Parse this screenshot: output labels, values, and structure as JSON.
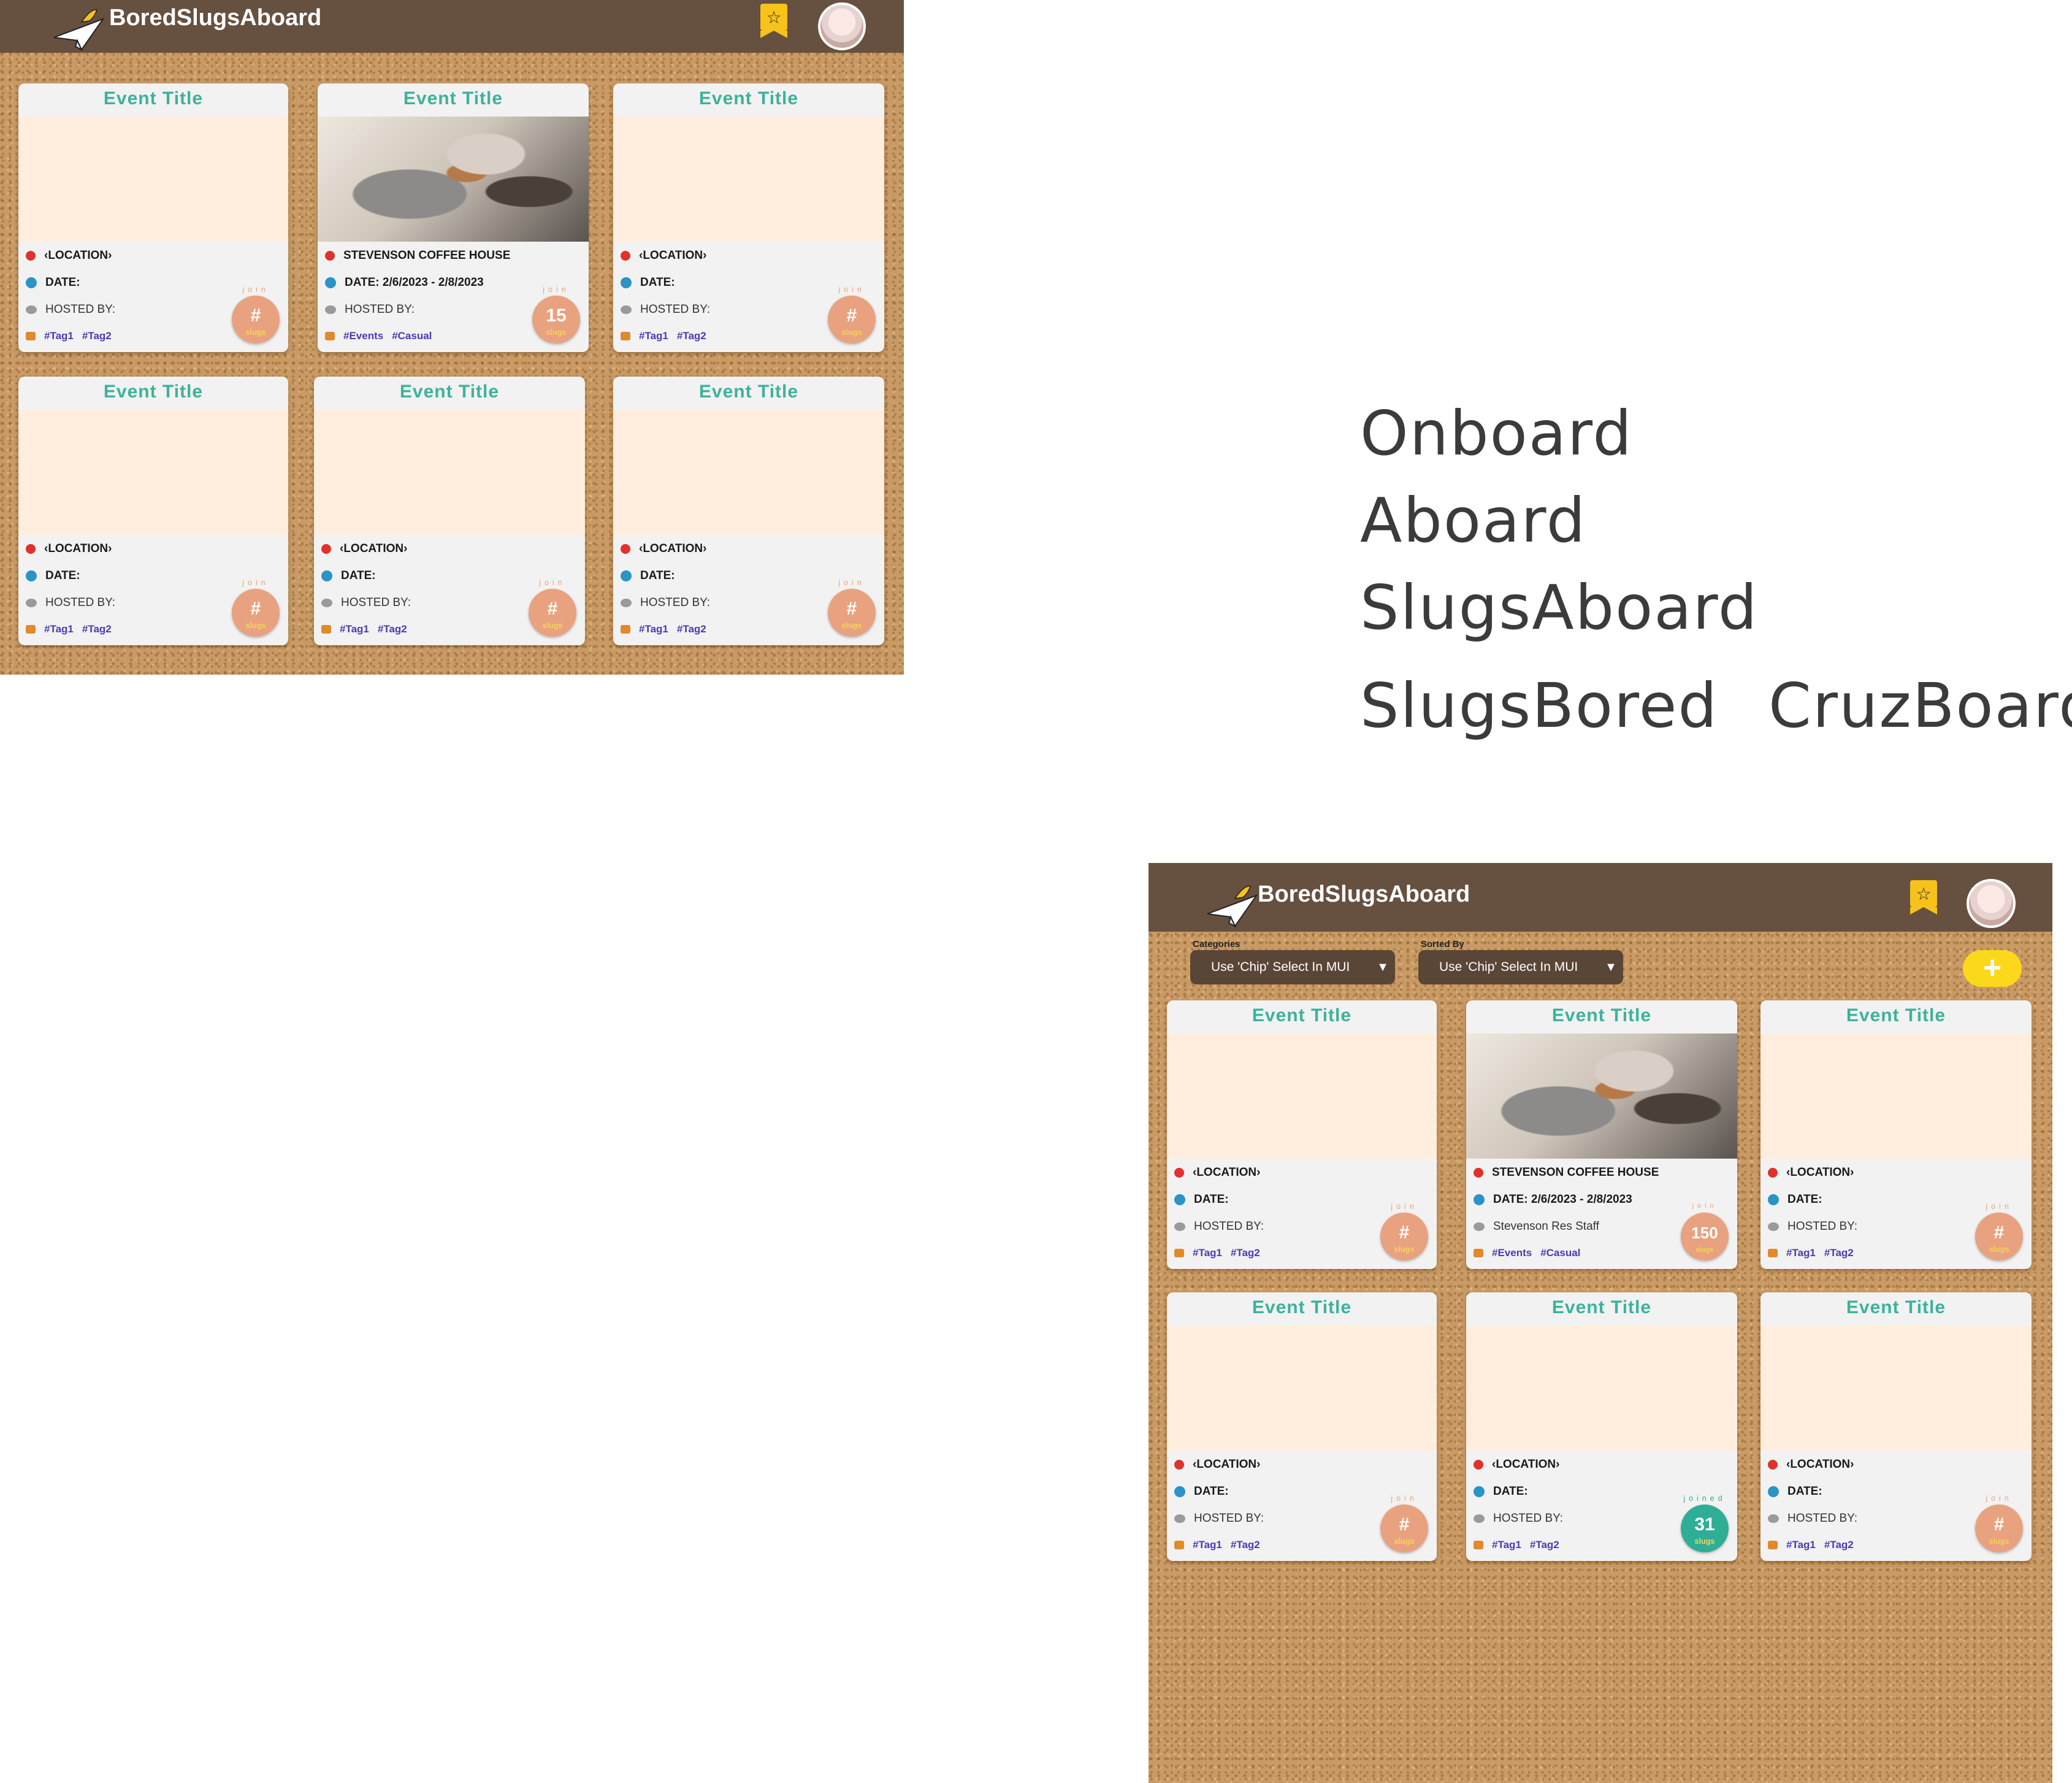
{
  "app": {
    "brand": "BoredSlugsAboard",
    "bookmark_icon": "star-bookmark-icon",
    "profile_icon": "avatar"
  },
  "wordmarks": [
    "Onboard",
    "Aboard",
    "SlugsAboard",
    "SlugsBored",
    "CruzBoard"
  ],
  "filters": {
    "categories_label": "Categories",
    "categories_value": "Use 'Chip' Select In MUI",
    "sorted_label": "Sorted By",
    "sorted_value": "Use 'Chip' Select In MUI",
    "add_label": "+"
  },
  "mockup1": {
    "cards": [
      {
        "title": "Event Title",
        "location": "‹LOCATION›",
        "date": "DATE:",
        "host": "HOSTED BY:",
        "tags": [
          "#Tag1",
          "#Tag2"
        ],
        "badge": "#",
        "badge_sub": "slugs",
        "badge_top": "join",
        "photo": false
      },
      {
        "title": "Event Title",
        "location": "STEVENSON COFFEE HOUSE",
        "date": "DATE: 2/6/2023 - 2/8/2023",
        "host": "HOSTED BY:",
        "tags": [
          "#Events",
          "#Casual"
        ],
        "badge": "15",
        "badge_sub": "slugs",
        "badge_top": "join",
        "photo": true
      },
      {
        "title": "Event Title",
        "location": "‹LOCATION›",
        "date": "DATE:",
        "host": "HOSTED BY:",
        "tags": [
          "#Tag1",
          "#Tag2"
        ],
        "badge": "#",
        "badge_sub": "slugs",
        "badge_top": "join",
        "photo": false
      },
      {
        "title": "Event Title",
        "location": "‹LOCATION›",
        "date": "DATE:",
        "host": "HOSTED BY:",
        "tags": [
          "#Tag1",
          "#Tag2"
        ],
        "badge": "#",
        "badge_sub": "slugs",
        "badge_top": "join",
        "photo": false
      },
      {
        "title": "Event Title",
        "location": "‹LOCATION›",
        "date": "DATE:",
        "host": "HOSTED BY:",
        "tags": [
          "#Tag1",
          "#Tag2"
        ],
        "badge": "#",
        "badge_sub": "slugs",
        "badge_top": "join",
        "photo": false
      },
      {
        "title": "Event Title",
        "location": "‹LOCATION›",
        "date": "DATE:",
        "host": "HOSTED BY:",
        "tags": [
          "#Tag1",
          "#Tag2"
        ],
        "badge": "#",
        "badge_sub": "slugs",
        "badge_top": "join",
        "photo": false
      }
    ]
  },
  "mockup2": {
    "cards": [
      {
        "title": "Event Title",
        "location": "‹LOCATION›",
        "date": "DATE:",
        "host": "HOSTED BY:",
        "tags": [
          "#Tag1",
          "#Tag2"
        ],
        "badge": "#",
        "badge_sub": "slugs",
        "badge_top": "join",
        "photo": false,
        "joined": false
      },
      {
        "title": "Event Title",
        "location": "STEVENSON COFFEE HOUSE",
        "date": "DATE: 2/6/2023 - 2/8/2023",
        "host": "Stevenson Res Staff",
        "tags": [
          "#Events",
          "#Casual"
        ],
        "badge": "150",
        "badge_sub": "slugs",
        "badge_top": "join",
        "photo": true,
        "joined": false
      },
      {
        "title": "Event Title",
        "location": "‹LOCATION›",
        "date": "DATE:",
        "host": "HOSTED BY:",
        "tags": [
          "#Tag1",
          "#Tag2"
        ],
        "badge": "#",
        "badge_sub": "slugs",
        "badge_top": "join",
        "photo": false,
        "joined": false
      },
      {
        "title": "Event Title",
        "location": "‹LOCATION›",
        "date": "DATE:",
        "host": "HOSTED BY:",
        "tags": [
          "#Tag1",
          "#Tag2"
        ],
        "badge": "#",
        "badge_sub": "slugs",
        "badge_top": "join",
        "photo": false,
        "joined": false
      },
      {
        "title": "Event Title",
        "location": "‹LOCATION›",
        "date": "DATE:",
        "host": "HOSTED BY:",
        "tags": [
          "#Tag1",
          "#Tag2"
        ],
        "badge": "31",
        "badge_sub": "slugs",
        "badge_top": "joined",
        "photo": false,
        "joined": true
      },
      {
        "title": "Event Title",
        "location": "‹LOCATION›",
        "date": "DATE:",
        "host": "HOSTED BY:",
        "tags": [
          "#Tag1",
          "#Tag2"
        ],
        "badge": "#",
        "badge_sub": "slugs",
        "badge_top": "join",
        "photo": false,
        "joined": false
      }
    ]
  },
  "colors": {
    "header": "#66503f",
    "title": "#3bb39b",
    "image_placeholder": "#ffeede",
    "badge": "#e9a27f",
    "badge_joined": "#2fae96",
    "bookmark": "#f7c21a",
    "tag_text": "#4a3bb0"
  }
}
